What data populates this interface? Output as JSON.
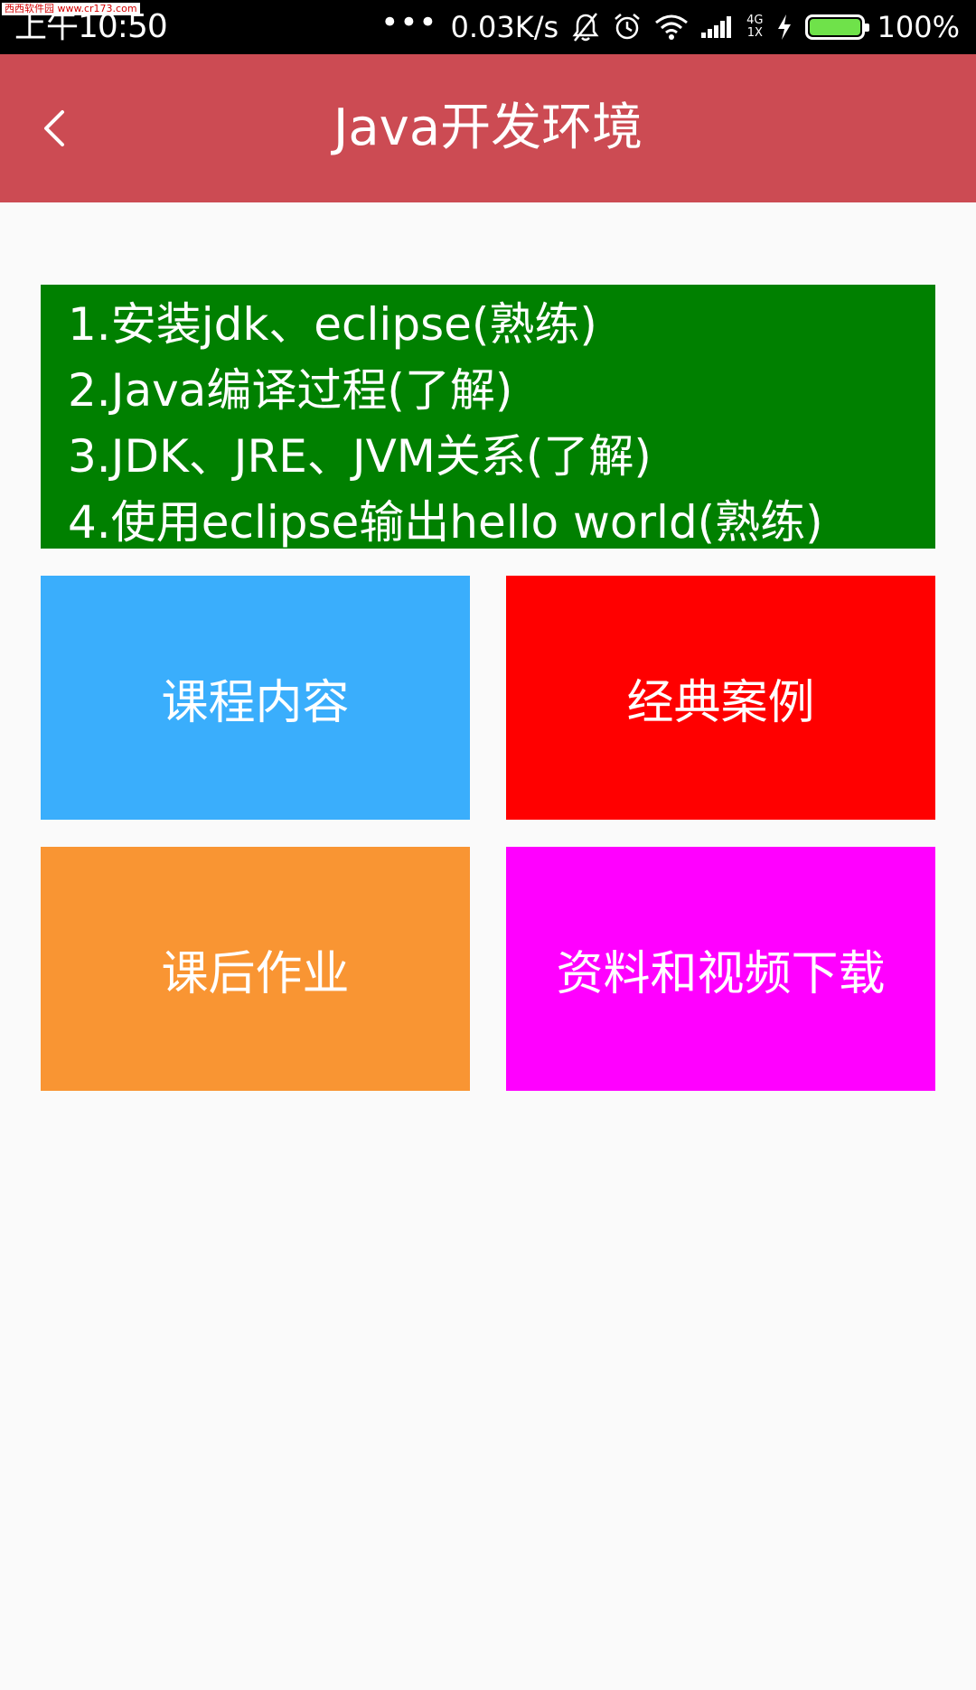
{
  "status_bar": {
    "time": "上午10:50",
    "watermark": "西西软件园 www.cr173.com",
    "dots": "•••",
    "speed": "0.03K/s",
    "network_top": "4G",
    "network_bottom": "1X",
    "battery_level": 1.0,
    "battery_text": "100%",
    "battery_color": "#6fe24a"
  },
  "app_bar": {
    "title": "Java开发环境",
    "color": "#cc4b53"
  },
  "topics": {
    "color": "#008000",
    "lines": [
      "1.安装jdk、eclipse(熟练)",
      "2.Java编译过程(了解)",
      "3.JDK、JRE、JVM关系(了解)",
      "4.使用eclipse输出hello world(熟练)"
    ]
  },
  "tiles": [
    {
      "label": "课程内容",
      "color": "#3aaefc"
    },
    {
      "label": "经典案例",
      "color": "#ff0000"
    },
    {
      "label": "课后作业",
      "color": "#f99533"
    },
    {
      "label": "资料和视频下载",
      "color": "#ff00ff"
    }
  ]
}
